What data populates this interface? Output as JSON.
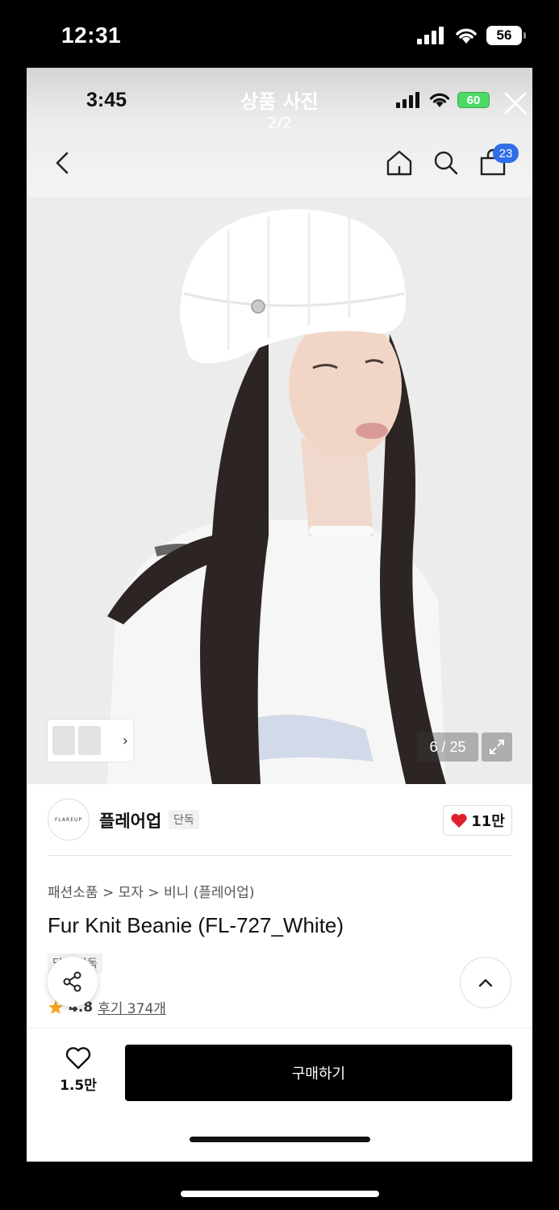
{
  "device": {
    "time": "12:31",
    "battery": "56"
  },
  "inner_status": {
    "time": "3:45",
    "battery": "60"
  },
  "header": {
    "title": "상품 사진",
    "page_indicator": "2/2",
    "cart_count": "23"
  },
  "photo": {
    "counter": "6 / 25"
  },
  "brand": {
    "logo_text": "FLAREUP",
    "name": "플레어업",
    "tag": "단독",
    "likes": "11만"
  },
  "product": {
    "breadcrumb": "패션소품 > 모자 > 비니 (플레어업)",
    "title": "Fur Knit Beanie (FL-727_White)",
    "exclusive_tag": "단독 단독",
    "rating": "4.8",
    "reviews": "후기 374개"
  },
  "bottom_bar": {
    "wish_count": "1.5만",
    "buy_label": "구매하기"
  },
  "colors": {
    "accent_blue": "#2f6ee8",
    "heart_red": "#e0202f",
    "star": "#f5a623",
    "buy_button": "#000000"
  }
}
